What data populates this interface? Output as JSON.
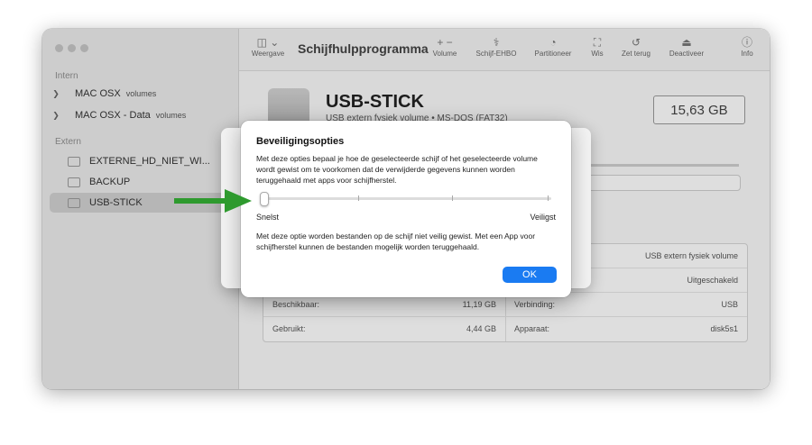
{
  "window": {
    "title": "Schijfhulpprogramma"
  },
  "sidebar": {
    "section_intern": "Intern",
    "section_extern": "Extern",
    "intern_items": [
      {
        "label": "MAC OSX",
        "sub": "volumes"
      },
      {
        "label": "MAC OSX - Data",
        "sub": "volumes"
      }
    ],
    "extern_items": [
      {
        "label": "EXTERNE_HD_NIET_WI..."
      },
      {
        "label": "BACKUP"
      },
      {
        "label": "USB-STICK"
      }
    ]
  },
  "toolbar": {
    "view_label": "Weergave",
    "volume_label": "Volume",
    "firstaid_label": "Schijf-EHBO",
    "partition_label": "Partitioneer",
    "erase_label": "Wis",
    "restore_label": "Zet terug",
    "share_label": "Deactiveer",
    "info_label": "Info"
  },
  "disk": {
    "name": "USB-STICK",
    "subtitle": "USB extern fysiek volume • MS-DOS (FAT32)",
    "capacity": "15,63 GB"
  },
  "info_table": {
    "rows": [
      {
        "key": "",
        "value": "",
        "key2": "",
        "value2": "USB extern fysiek volume"
      },
      {
        "key": "",
        "value": "",
        "key2": "",
        "value2": "Uitgeschakeld"
      },
      {
        "key": "Beschikbaar:",
        "value": "11,19 GB",
        "key2": "Verbinding:",
        "value2": "USB"
      },
      {
        "key": "Gebruikt:",
        "value": "4,44 GB",
        "key2": "Apparaat:",
        "value2": "disk5s1"
      }
    ]
  },
  "dialog": {
    "title": "Beveiligingsopties",
    "description": "Met deze opties bepaal je hoe de geselecteerde schijf of het geselecteerde volume wordt gewist om te voorkomen dat de verwijderde gegevens kunnen worden teruggehaald met apps voor schijfherstel.",
    "slider_min_label": "Snelst",
    "slider_max_label": "Veiligst",
    "slider_level": 0,
    "slider_steps": 4,
    "explanation": "Met deze optie worden bestanden op de schijf niet veilig gewist. Met een App voor schijfherstel kunnen de bestanden mogelijk worden teruggehaald.",
    "ok_label": "OK"
  },
  "colors": {
    "accent": "#1a7bf2",
    "annotation_arrow": "#2e9a2e"
  }
}
